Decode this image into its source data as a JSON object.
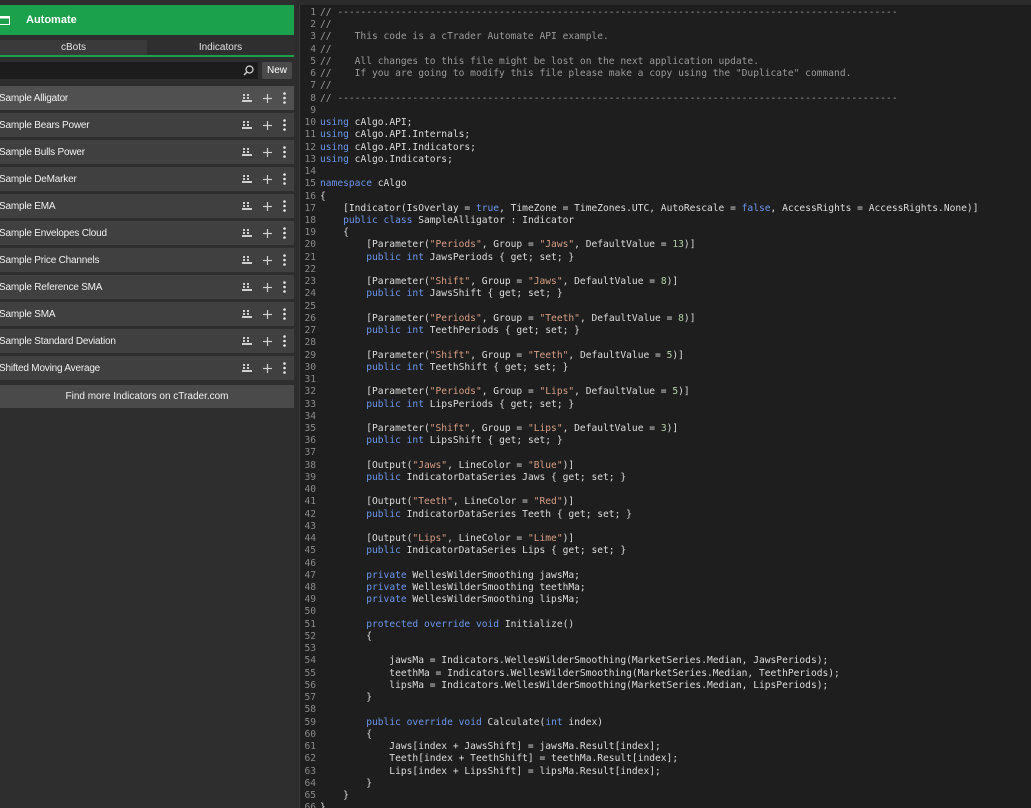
{
  "header": {
    "title": "Automate"
  },
  "tabs": [
    {
      "label": "cBots"
    },
    {
      "label": "Indicators"
    }
  ],
  "search": {
    "placeholder": ""
  },
  "new_button": {
    "label": "New"
  },
  "indicators": [
    {
      "label": "Sample Alligator",
      "selected": true
    },
    {
      "label": "Sample Bears Power"
    },
    {
      "label": "Sample Bulls Power"
    },
    {
      "label": "Sample DeMarker"
    },
    {
      "label": "Sample EMA"
    },
    {
      "label": "Sample Envelopes Cloud"
    },
    {
      "label": "Sample Price Channels"
    },
    {
      "label": "Sample Reference SMA"
    },
    {
      "label": "Sample SMA"
    },
    {
      "label": "Sample Standard Deviation"
    },
    {
      "label": "Shifted Moving Average"
    }
  ],
  "find_more": {
    "label": "Find more Indicators on cTrader.com"
  },
  "colors": {
    "accent": "#1ba04b",
    "panel": "#2e2e2e",
    "editor_bg": "#1e1e1e",
    "keyword": "#6c95eb",
    "string": "#d69d85",
    "number": "#b5cea8",
    "comment": "#9a9a9a"
  },
  "icons": {
    "header": "calendar-icon",
    "search": "search-icon",
    "row_actions": [
      "cloud-icon",
      "plus-icon",
      "kebab-icon"
    ]
  },
  "code_lines": [
    "// -------------------------------------------------------------------------------------------------",
    "//",
    "//    This code is a cTrader Automate API example.",
    "//",
    "//    All changes to this file might be lost on the next application update.",
    "//    If you are going to modify this file please make a copy using the \"Duplicate\" command.",
    "//",
    "// -------------------------------------------------------------------------------------------------",
    "",
    "using cAlgo.API;",
    "using cAlgo.API.Internals;",
    "using cAlgo.API.Indicators;",
    "using cAlgo.Indicators;",
    "",
    "namespace cAlgo",
    "{",
    "    [Indicator(IsOverlay = true, TimeZone = TimeZones.UTC, AutoRescale = false, AccessRights = AccessRights.None)]",
    "    public class SampleAlligator : Indicator",
    "    {",
    "        [Parameter(\"Periods\", Group = \"Jaws\", DefaultValue = 13)]",
    "        public int JawsPeriods { get; set; }",
    "",
    "        [Parameter(\"Shift\", Group = \"Jaws\", DefaultValue = 8)]",
    "        public int JawsShift { get; set; }",
    "",
    "        [Parameter(\"Periods\", Group = \"Teeth\", DefaultValue = 8)]",
    "        public int TeethPeriods { get; set; }",
    "",
    "        [Parameter(\"Shift\", Group = \"Teeth\", DefaultValue = 5)]",
    "        public int TeethShift { get; set; }",
    "",
    "        [Parameter(\"Periods\", Group = \"Lips\", DefaultValue = 5)]",
    "        public int LipsPeriods { get; set; }",
    "",
    "        [Parameter(\"Shift\", Group = \"Lips\", DefaultValue = 3)]",
    "        public int LipsShift { get; set; }",
    "",
    "        [Output(\"Jaws\", LineColor = \"Blue\")]",
    "        public IndicatorDataSeries Jaws { get; set; }",
    "",
    "        [Output(\"Teeth\", LineColor = \"Red\")]",
    "        public IndicatorDataSeries Teeth { get; set; }",
    "",
    "        [Output(\"Lips\", LineColor = \"Lime\")]",
    "        public IndicatorDataSeries Lips { get; set; }",
    "",
    "        private WellesWilderSmoothing jawsMa;",
    "        private WellesWilderSmoothing teethMa;",
    "        private WellesWilderSmoothing lipsMa;",
    "",
    "        protected override void Initialize()",
    "        {",
    "",
    "            jawsMa = Indicators.WellesWilderSmoothing(MarketSeries.Median, JawsPeriods);",
    "            teethMa = Indicators.WellesWilderSmoothing(MarketSeries.Median, TeethPeriods);",
    "            lipsMa = Indicators.WellesWilderSmoothing(MarketSeries.Median, LipsPeriods);",
    "        }",
    "",
    "        public override void Calculate(int index)",
    "        {",
    "            Jaws[index + JawsShift] = jawsMa.Result[index];",
    "            Teeth[index + TeethShift] = teethMa.Result[index];",
    "            Lips[index + LipsShift] = lipsMa.Result[index];",
    "        }",
    "    }",
    "}"
  ]
}
